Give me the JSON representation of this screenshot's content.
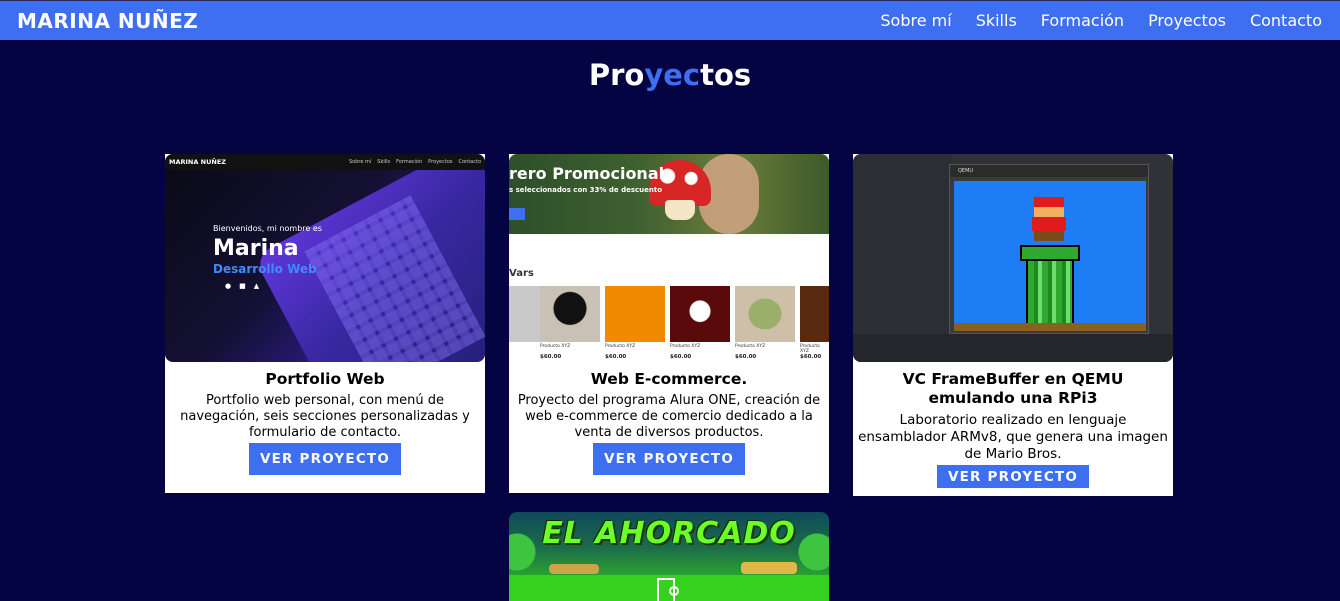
{
  "navbar": {
    "brand": "MARINA NUÑEZ",
    "links": [
      "Sobre mí",
      "Skills",
      "Formación",
      "Proyectos",
      "Contacto"
    ]
  },
  "section": {
    "title_part1": "Pro",
    "title_part2": "yec",
    "title_part3": "tos"
  },
  "projects": [
    {
      "title": "Portfolio Web",
      "description": "Portfolio web personal, con menú de navegación, seis secciones personalizadas y formulario de contacto.",
      "button": "VER PROYECTO",
      "thumb": {
        "brand": "MARINA NUÑEZ",
        "links": [
          "Sobre mí",
          "Skills",
          "Formación",
          "Proyectos",
          "Contacto"
        ],
        "welcome": "Bienvenidos, mi nombre es",
        "name": "Marina",
        "role": "Desarrollo Web"
      }
    },
    {
      "title": "Web E-commerce.",
      "description": "Proyecto del programa Alura ONE, creación de web e-commerce de comercio dedicado a la venta de diversos productos.",
      "button": "VER PROYECTO",
      "thumb": {
        "banner_title": "rero Promocional",
        "banner_sub": "s seleccionados con 33% de descuento",
        "section": "Vars",
        "product_label": "Producto XYZ",
        "price": "$60.00"
      }
    },
    {
      "title": "VC FrameBuffer en QEMU emulando una RPi3",
      "description": "Laboratorio realizado en lenguaje ensamblador ARMv8, que genera una imagen de Mario Bros.",
      "button": "VER PROYECTO",
      "thumb": {
        "window_title": "QEMU"
      }
    },
    {
      "title": "El Ahorcado",
      "thumb": {
        "game_title": "EL AHORCADO"
      }
    }
  ],
  "colors": {
    "accent": "#3d6ff0",
    "background": "#040442"
  }
}
